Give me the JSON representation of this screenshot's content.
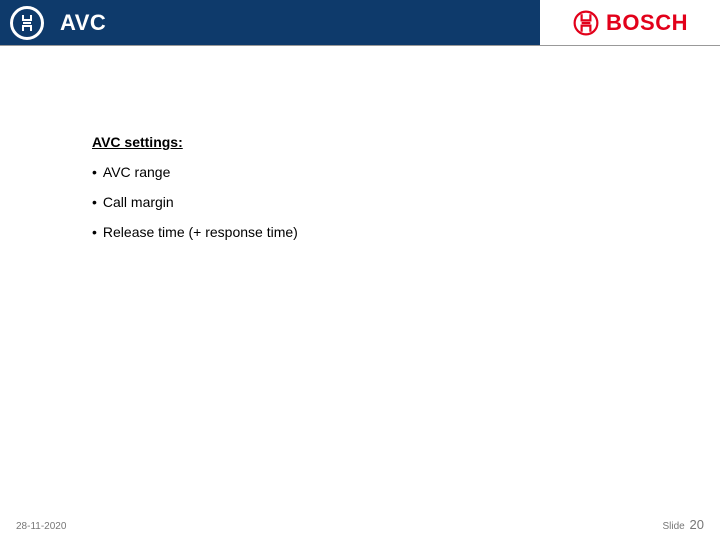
{
  "header": {
    "title": "AVC",
    "brand_word": "BOSCH",
    "brand_color": "#e2001a",
    "bar_color": "#0e3a6b"
  },
  "content": {
    "heading": "AVC settings:",
    "bullets": [
      "AVC range",
      "Call margin",
      "Release time (+ response time)"
    ]
  },
  "footer": {
    "date": "28-11-2020",
    "slide_label": "Slide",
    "slide_number": "20"
  }
}
